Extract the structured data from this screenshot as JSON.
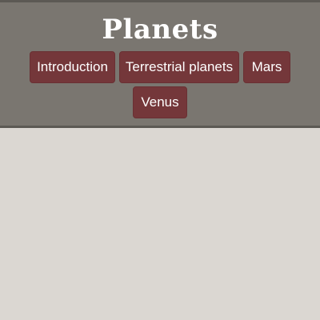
{
  "header": {
    "title": "Planets"
  },
  "nav": {
    "items": [
      {
        "label": "Introduction"
      },
      {
        "label": "Terrestrial planets"
      },
      {
        "label": "Mars"
      },
      {
        "label": "Venus"
      }
    ]
  },
  "colors": {
    "header_bg": "#7a7670",
    "page_bg": "#dbd7d2",
    "button_bg": "#74373a",
    "text": "#ffffff"
  }
}
